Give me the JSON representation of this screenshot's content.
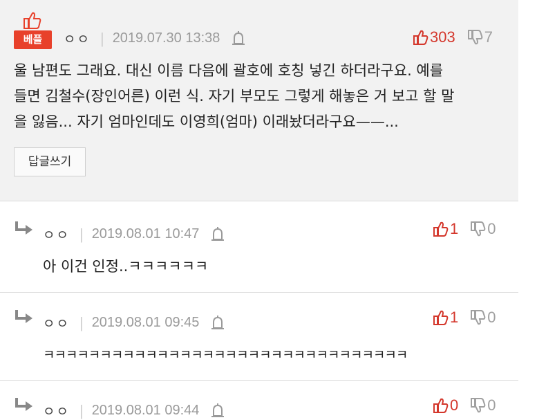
{
  "best_comment": {
    "badge": "베플",
    "author": "ㅇㅇ",
    "timestamp": "2019.07.30 13:38",
    "upvotes": "303",
    "downvotes": "7",
    "lines": [
      "울 남편도 그래요. 대신 이름 다음에 괄호에 호칭 넣긴 하더라구요. 예를",
      "들면 김철수(장인어른) 이런 식. 자기 부모도 그렇게 해놓은 거 보고 할 말",
      "을 잃음... 자기 엄마인데도 이영희(엄마) 이래놨더라구요——..."
    ],
    "reply_button": "답글쓰기"
  },
  "replies": [
    {
      "author": "ㅇㅇ",
      "timestamp": "2019.08.01 10:47",
      "upvotes": "1",
      "downvotes": "0",
      "text": "아 이건 인정..ㅋㅋㅋㅋㅋㅋ"
    },
    {
      "author": "ㅇㅇ",
      "timestamp": "2019.08.01 09:45",
      "upvotes": "1",
      "downvotes": "0",
      "text": "ㅋㅋㅋㅋㅋㅋㅋㅋㅋㅋㅋㅋㅋㅋㅋㅋㅋㅋㅋㅋㅋㅋㅋㅋㅋㅋㅋㅋㅋㅋㅋㅋ"
    },
    {
      "author": "ㅇㅇ",
      "timestamp": "2019.08.01 09:44",
      "upvotes": "0",
      "downvotes": "0",
      "text": ""
    }
  ],
  "icons": {
    "upvote": "thumbs-up-icon",
    "downvote": "thumbs-down-icon",
    "report": "bell-icon",
    "reply": "reply-arrow-icon"
  },
  "colors": {
    "accent": "#e8412b",
    "upvote": "#d4372c",
    "muted": "#9a9a9a",
    "best_bg": "#f2f2f2"
  }
}
